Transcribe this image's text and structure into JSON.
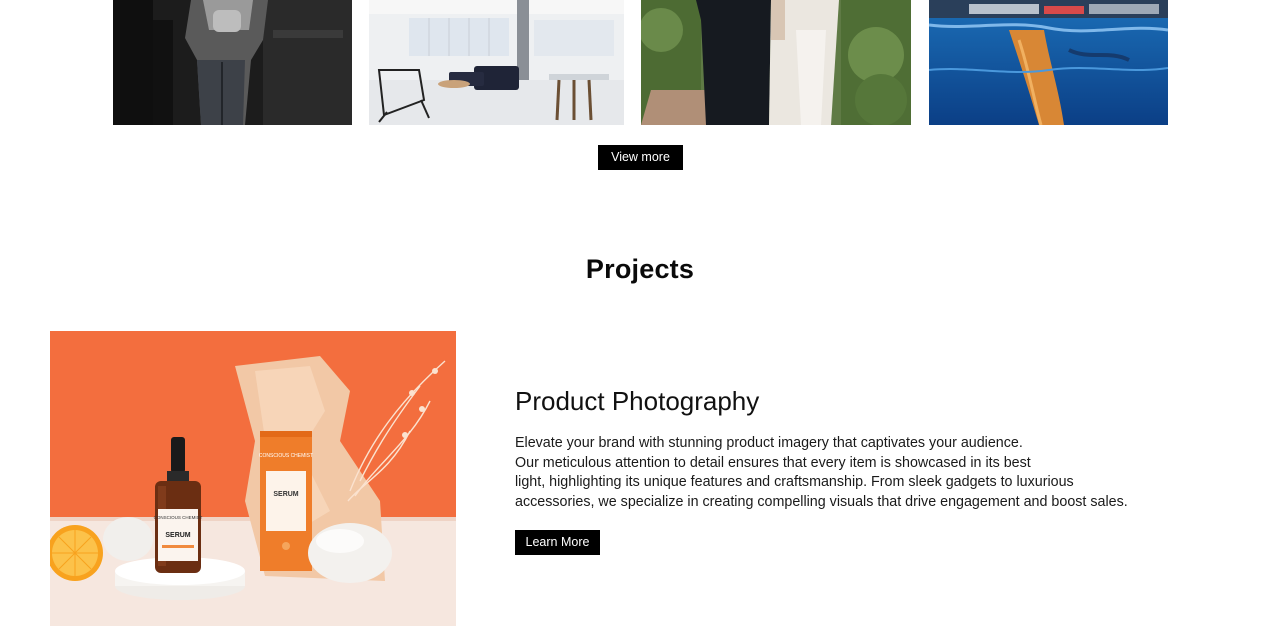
{
  "gallery": {
    "items": [
      {
        "alt_icon": "portrait-bw-photo"
      },
      {
        "alt_icon": "interior-photo"
      },
      {
        "alt_icon": "wedding-photo"
      },
      {
        "alt_icon": "waterfront-photo"
      }
    ],
    "view_more_label": "View more"
  },
  "projects": {
    "heading": "Projects",
    "item": {
      "title": "Product Photography",
      "description_lines": [
        "Elevate your brand with stunning product imagery that captivates your audience.",
        "Our meticulous attention to detail ensures that every item is showcased in its best",
        "light, highlighting its unique features and craftsmanship. From sleek gadgets to luxurious",
        "accessories, we specialize in creating compelling visuals that drive engagement and boost sales."
      ],
      "cta_label": "Learn More",
      "product_brand": "CONSCIOUS CHEMIST",
      "product_name": "SERUM"
    }
  },
  "colors": {
    "accent_orange": "#f36e3e",
    "button_bg": "#000000",
    "button_text": "#ffffff"
  }
}
